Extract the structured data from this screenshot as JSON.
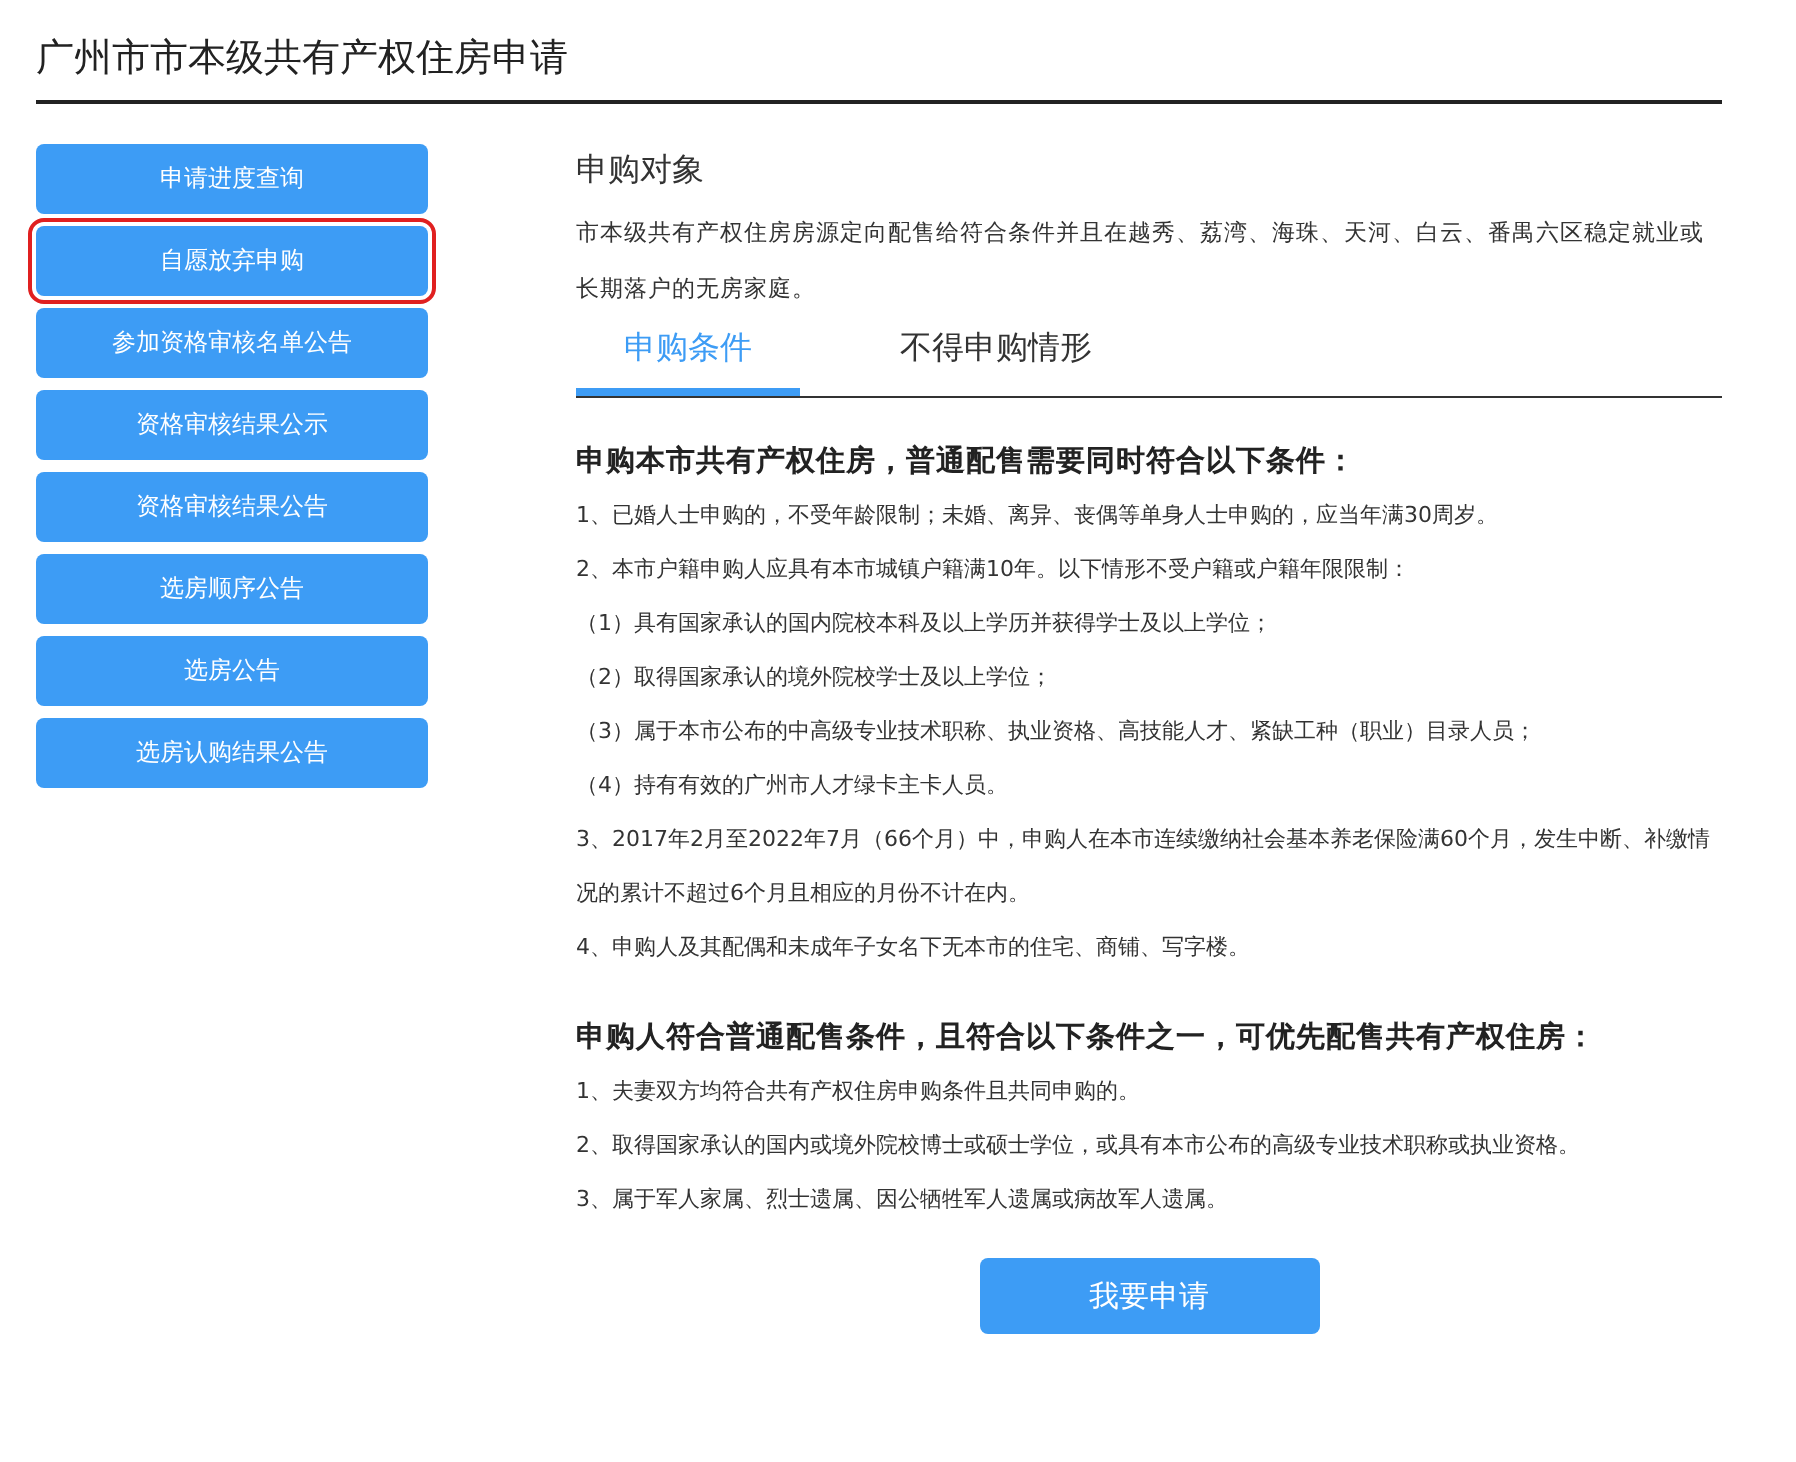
{
  "page_title": "广州市市本级共有产权住房申请",
  "sidebar": {
    "items": [
      {
        "label": "申请进度查询",
        "selected": false
      },
      {
        "label": "自愿放弃申购",
        "selected": true
      },
      {
        "label": "参加资格审核名单公告",
        "selected": false
      },
      {
        "label": "资格审核结果公示",
        "selected": false
      },
      {
        "label": "资格审核结果公告",
        "selected": false
      },
      {
        "label": "选房顺序公告",
        "selected": false
      },
      {
        "label": "选房公告",
        "selected": false
      },
      {
        "label": "选房认购结果公告",
        "selected": false
      }
    ]
  },
  "intro": {
    "heading": "申购对象",
    "text": "市本级共有产权住房房源定向配售给符合条件并且在越秀、荔湾、海珠、天河、白云、番禺六区稳定就业或长期落户的无房家庭。"
  },
  "tabs": [
    {
      "label": "申购条件",
      "selected": true
    },
    {
      "label": "不得申购情形",
      "selected": false
    }
  ],
  "sections": [
    {
      "heading": "申购本市共有产权住房，普通配售需要同时符合以下条件：",
      "items": [
        "1、已婚人士申购的，不受年龄限制；未婚、离异、丧偶等单身人士申购的，应当年满30周岁。",
        "2、本市户籍申购人应具有本市城镇户籍满10年。以下情形不受户籍或户籍年限限制：",
        "（1）具有国家承认的国内院校本科及以上学历并获得学士及以上学位；",
        "（2）取得国家承认的境外院校学士及以上学位；",
        "（3）属于本市公布的中高级专业技术职称、执业资格、高技能人才、紧缺工种（职业）目录人员；",
        "（4）持有有效的广州市人才绿卡主卡人员。",
        "3、2017年2月至2022年7月（66个月）中，申购人在本市连续缴纳社会基本养老保险满60个月，发生中断、补缴情况的累计不超过6个月且相应的月份不计在内。",
        "4、申购人及其配偶和未成年子女名下无本市的住宅、商铺、写字楼。"
      ]
    },
    {
      "heading": "申购人符合普通配售条件，且符合以下条件之一，可优先配售共有产权住房：",
      "items": [
        "1、夫妻双方均符合共有产权住房申购条件且共同申购的。",
        "2、取得国家承认的国内或境外院校博士或硕士学位，或具有本市公布的高级专业技术职称或执业资格。",
        "3、属于军人家属、烈士遗属、因公牺牲军人遗属或病故军人遗属。"
      ]
    }
  ],
  "apply_button": "我要申请"
}
